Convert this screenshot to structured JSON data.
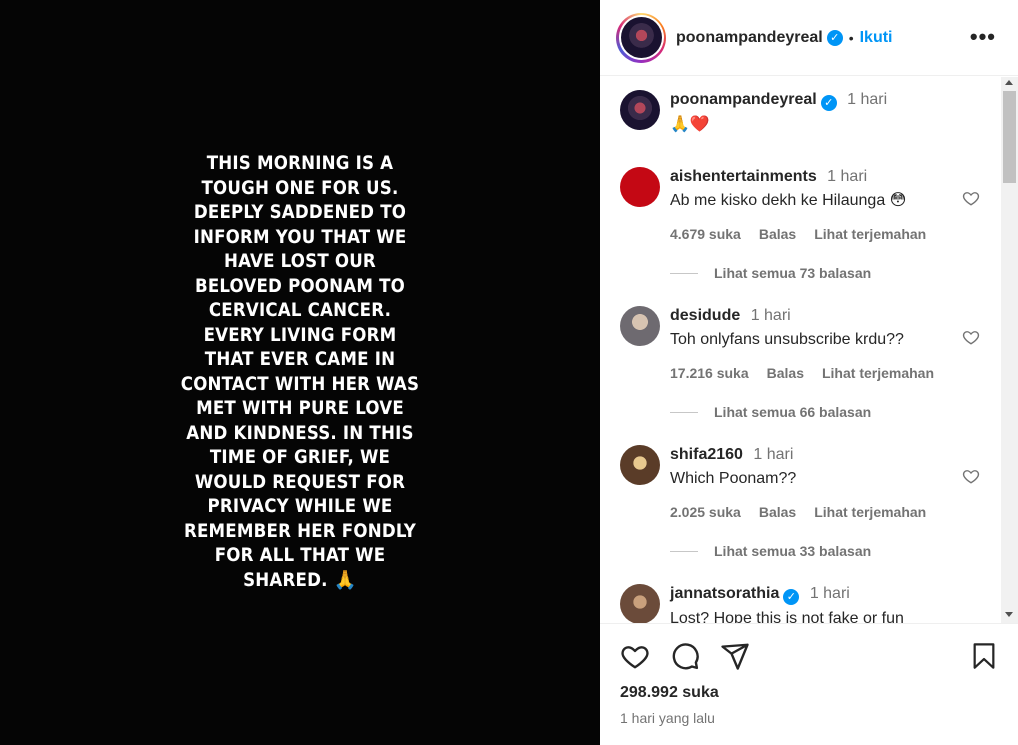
{
  "post": {
    "story_text": "THIS MORNING IS A\nTOUGH ONE FOR US.\nDEEPLY SADDENED TO\nINFORM YOU THAT WE\nHAVE LOST OUR\nBELOVED POONAM TO\nCERVICAL CANCER.\nEVERY LIVING FORM\nTHAT EVER CAME IN\nCONTACT WITH HER WAS\nMET WITH PURE LOVE\nAND KINDNESS. IN THIS\nTIME OF GRIEF, WE\nWOULD REQUEST FOR\nPRIVACY WHILE WE\nREMEMBER HER FONDLY\nFOR ALL THAT WE\nSHARED. 🙏"
  },
  "header": {
    "username": "poonampandeyreal",
    "dot": "•",
    "follow_label": "Ikuti",
    "more_label": "•••",
    "verified_mark": "✓"
  },
  "caption": {
    "username": "poonampandeyreal",
    "time": "1 hari",
    "text": "🙏❤️"
  },
  "comments": [
    {
      "username": "aishentertainments",
      "time": "1 hari",
      "text": "Ab me kisko dekh ke Hilaunga 😳",
      "likes": "4.679 suka",
      "reply": "Balas",
      "translate": "Lihat terjemahan",
      "replies": "Lihat semua 73 balasan",
      "verified": false
    },
    {
      "username": "desidude",
      "time": "1 hari",
      "text": "Toh onlyfans unsubscribe krdu??",
      "likes": "17.216 suka",
      "reply": "Balas",
      "translate": "Lihat terjemahan",
      "replies": "Lihat semua 66 balasan",
      "verified": false
    },
    {
      "username": "shifa2160",
      "time": "1 hari",
      "text": "Which Poonam??",
      "likes": "2.025 suka",
      "reply": "Balas",
      "translate": "Lihat terjemahan",
      "replies": "Lihat semua 33 balasan",
      "verified": false
    },
    {
      "username": "jannatsorathia",
      "time": "1 hari",
      "text": "Lost? Hope this is not fake or fun",
      "verified": true
    }
  ],
  "footer": {
    "likes": "298.992 suka",
    "posted": "1 hari yang lalu"
  },
  "icons": {
    "like": "heart-icon",
    "comment": "comment-icon",
    "share": "share-icon",
    "save": "bookmark-icon"
  },
  "colors": {
    "accent": "#0095f6",
    "muted": "#737373",
    "media_bg": "#050505"
  }
}
